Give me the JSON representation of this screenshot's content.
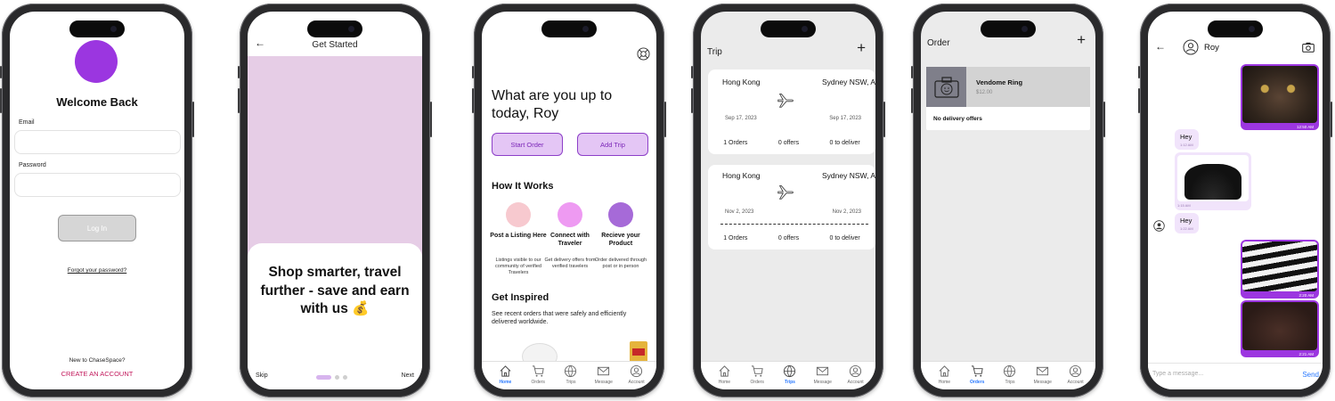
{
  "login": {
    "title": "Welcome Back",
    "email_label": "Email",
    "password_label": "Password",
    "login_button": "Log In",
    "forgot": "Forgot your password?",
    "new_to": "New to ChaseSpace?",
    "create_account": "CREATE AN ACCOUNT"
  },
  "get_started": {
    "title": "Get Started",
    "hero_text": "Shop smarter, travel further - save and earn with us 💰",
    "skip": "Skip",
    "next": "Next"
  },
  "home": {
    "greeting": "What are you up to today, Roy",
    "start_order": "Start Order",
    "add_trip": "Add Trip",
    "how_it_works": "How It Works",
    "steps": [
      {
        "title": "Post a Listing Here",
        "desc": "Listings visible to our community of verified Travelers",
        "color": "#f7c9cf"
      },
      {
        "title": "Connect with Traveler",
        "desc": "Get delivery offers from verified travelers",
        "color": "#ee9af2"
      },
      {
        "title": "Recieve your Product",
        "desc": "Order delivered through post or in person",
        "color": "#a66ad8"
      }
    ],
    "get_inspired": "Get Inspired",
    "inspired_desc": "See recent orders that were safely and efficiently delivered worldwide."
  },
  "tabs": {
    "home": "Home",
    "orders": "Orders",
    "trips": "Trips",
    "message": "Message",
    "account": "Account"
  },
  "trips": {
    "title": "Trip",
    "items": [
      {
        "from": "Hong Kong",
        "to": "Sydney NSW, A",
        "date_from": "Sep 17, 2023",
        "date_to": "Sep 17, 2023",
        "orders": "1 Orders",
        "offers": "0 offers",
        "deliver": "0 to deliver"
      },
      {
        "from": "Hong Kong",
        "to": "Sydney NSW, A",
        "date_from": "Nov 2, 2023",
        "date_to": "Nov 2, 2023",
        "orders": "1 Orders",
        "offers": "0 offers",
        "deliver": "0 to deliver"
      }
    ]
  },
  "orders": {
    "title": "Order",
    "item_name": "Vendome Ring",
    "item_price": "$12.00",
    "status": "No delivery offers"
  },
  "chat": {
    "name": "Roy",
    "messages": [
      {
        "text": "Hey",
        "time": "1:12 AM"
      },
      {
        "text": "Hey",
        "time": "1:22 AM"
      }
    ],
    "img_times": [
      "12:50 AM",
      "1:15 AM",
      "2:20 AM",
      "2:21 AM"
    ],
    "input_placeholder": "Type a message...",
    "send": "Send"
  },
  "colors": {
    "accent_purple": "#9c36e0",
    "create_account": "#c2185b",
    "active_tab": "#2979ff"
  }
}
